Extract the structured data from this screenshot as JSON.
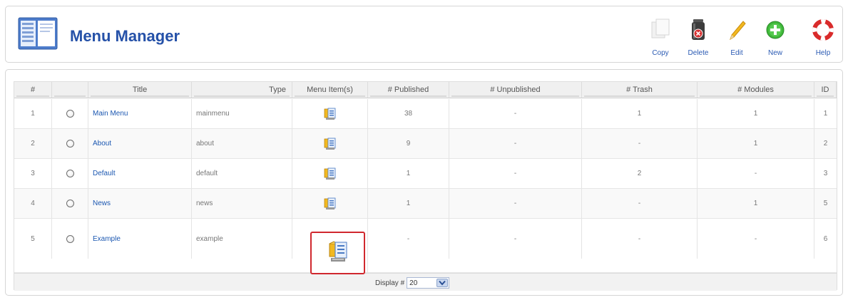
{
  "header": {
    "title": "Menu Manager"
  },
  "toolbar": {
    "copy_label": "Copy",
    "delete_label": "Delete",
    "edit_label": "Edit",
    "new_label": "New",
    "help_label": "Help"
  },
  "table": {
    "columns": [
      "#",
      "",
      "Title",
      "Type",
      "Menu Item(s)",
      "# Published",
      "# Unpublished",
      "# Trash",
      "# Modules",
      "ID"
    ],
    "rows": [
      {
        "num": "1",
        "title": "Main Menu",
        "type": "mainmenu",
        "published": "38",
        "unpublished": "-",
        "trash": "1",
        "modules": "1",
        "id": "1"
      },
      {
        "num": "2",
        "title": "About",
        "type": "about",
        "published": "9",
        "unpublished": "-",
        "trash": "-",
        "modules": "1",
        "id": "2"
      },
      {
        "num": "3",
        "title": "Default",
        "type": "default",
        "published": "1",
        "unpublished": "-",
        "trash": "2",
        "modules": "-",
        "id": "3"
      },
      {
        "num": "4",
        "title": "News",
        "type": "news",
        "published": "1",
        "unpublished": "-",
        "trash": "-",
        "modules": "1",
        "id": "5"
      },
      {
        "num": "5",
        "title": "Example",
        "type": "example",
        "published": "-",
        "unpublished": "-",
        "trash": "-",
        "modules": "-",
        "id": "6"
      }
    ]
  },
  "footer": {
    "display_label": "Display #",
    "display_value": "20"
  },
  "colors": {
    "title": "#2551a8",
    "link": "#1b57b1",
    "highlight": "#d0282e"
  }
}
